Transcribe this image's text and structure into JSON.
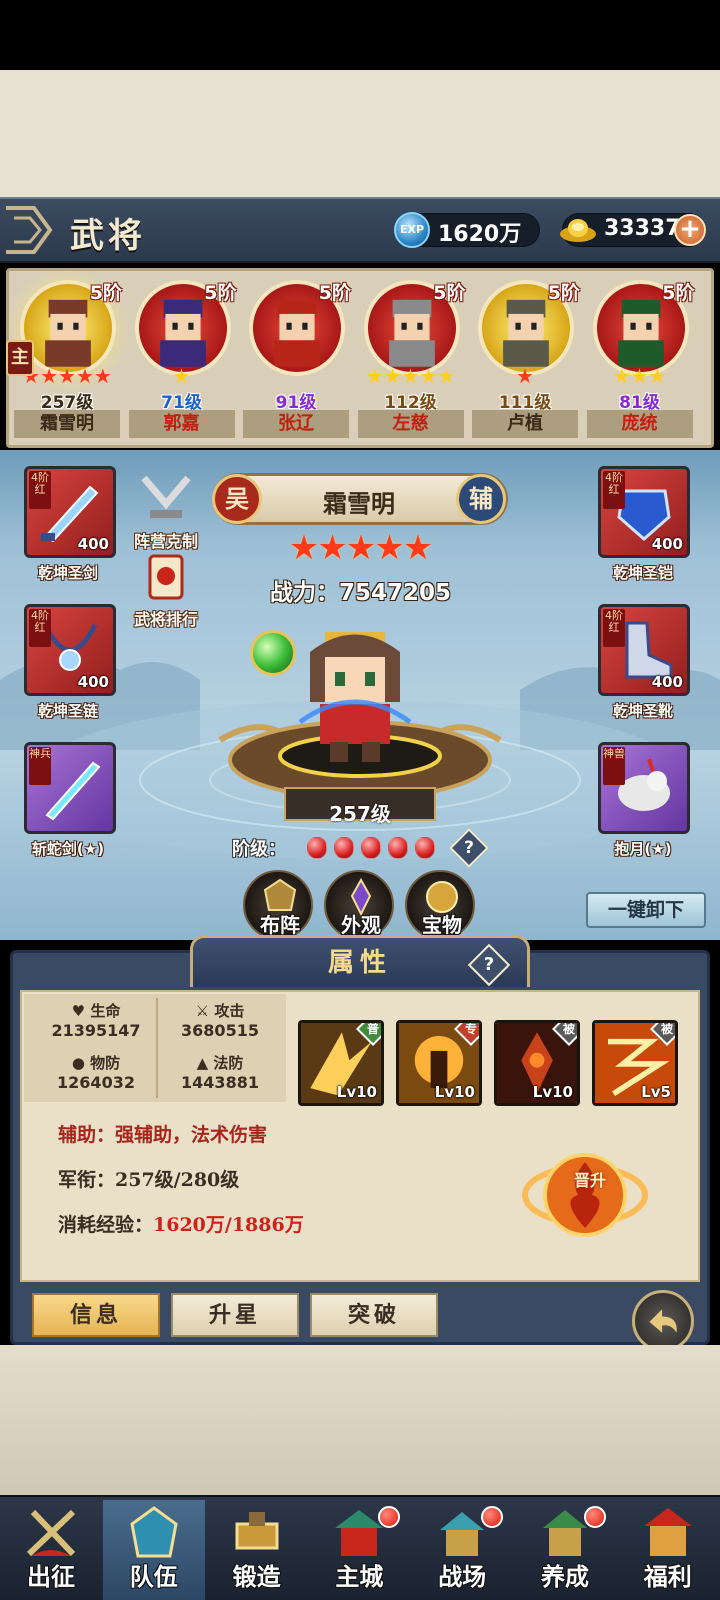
{
  "header": {
    "title": "武将",
    "exp_icon_text": "EXP",
    "exp_value": "1620万",
    "gold_value": "33337",
    "add_label": "+"
  },
  "roster": [
    {
      "name": "霜雪明",
      "rank": "5阶",
      "stars": "★★★★★",
      "star_color": "#ff3a1a",
      "level": "257级",
      "level_color": "#3a2a18",
      "name_color": "#3a2a18",
      "ring": "gold",
      "selected": true
    },
    {
      "name": "郭嘉",
      "rank": "5阶",
      "stars": "★",
      "star_color": "#ffcc22",
      "level": "71级",
      "level_color": "#1f5fd0",
      "name_color": "#c02010",
      "ring": "red",
      "selected": false
    },
    {
      "name": "张辽",
      "rank": "5阶",
      "stars": "",
      "star_color": "#ffcc22",
      "level": "91级",
      "level_color": "#8a2ad0",
      "name_color": "#c02010",
      "ring": "red",
      "selected": false
    },
    {
      "name": "左慈",
      "rank": "5阶",
      "stars": "★★★★★",
      "star_color": "#ffcc22",
      "level": "112级",
      "level_color": "#7a4a10",
      "name_color": "#c02010",
      "ring": "red",
      "selected": false
    },
    {
      "name": "卢植",
      "rank": "5阶",
      "stars": "★",
      "star_color": "#ff3a1a",
      "level": "111级",
      "level_color": "#7a4a10",
      "name_color": "#3a2a18",
      "ring": "gold",
      "selected": false
    },
    {
      "name": "庞统",
      "rank": "5阶",
      "stars": "★★★",
      "star_color": "#ffcc22",
      "level": "81级",
      "level_color": "#8a2ad0",
      "name_color": "#c02010",
      "ring": "red",
      "selected": false
    }
  ],
  "main_badge": "主",
  "left_equips": [
    {
      "name": "乾坤圣剑",
      "tag": "4阶红",
      "count": "400",
      "icon": "sword-icon"
    },
    {
      "name": "乾坤圣链",
      "tag": "4阶红",
      "count": "400",
      "icon": "necklace-icon"
    },
    {
      "name": "斩蛇剑(★)",
      "tag": "神兵",
      "count": "",
      "icon": "divine-sword-icon"
    }
  ],
  "right_equips": [
    {
      "name": "乾坤圣铠",
      "tag": "4阶红",
      "count": "400",
      "icon": "armor-icon"
    },
    {
      "name": "乾坤圣靴",
      "tag": "4阶红",
      "count": "400",
      "icon": "boots-icon"
    },
    {
      "name": "抱月(★)",
      "tag": "神兽",
      "count": "",
      "icon": "divine-mount-icon"
    }
  ],
  "side_buttons": {
    "formation_guide": "阵营克制",
    "ranking": "武将排行"
  },
  "hero": {
    "faction": "吴",
    "role": "辅",
    "name": "霜雪明",
    "stars": "★★★★★",
    "power_label": "战力：",
    "power_value": "7547205",
    "level": "257级",
    "grade_label": "阶级：",
    "grade_gems": 5,
    "help": "?"
  },
  "actions": {
    "formation": "布阵",
    "appearance": "外观",
    "treasure": "宝物",
    "unequip_all": "一键卸下"
  },
  "attributes": {
    "title": "属性",
    "help": "?",
    "stats": [
      {
        "key": "生命",
        "value": "21395147"
      },
      {
        "key": "攻击",
        "value": "3680515"
      },
      {
        "key": "物防",
        "value": "1264032"
      },
      {
        "key": "法防",
        "value": "1443881"
      }
    ],
    "skills": [
      {
        "tag": "普",
        "tag_color": "#3f8c3a",
        "level": "Lv10"
      },
      {
        "tag": "专",
        "tag_color": "#c0402a",
        "level": "Lv10"
      },
      {
        "tag": "被",
        "tag_color": "#5a5a5a",
        "level": "Lv10"
      },
      {
        "tag": "被",
        "tag_color": "#5a5a5a",
        "level": "Lv5"
      }
    ],
    "support_label": "辅助：",
    "support_value": "强辅助，法术伤害",
    "rank_label": "军衔：",
    "rank_value": "257级/280级",
    "exp_label": "消耗经验：",
    "exp_value": "1620万/1886万",
    "ascend_label": "晋升"
  },
  "tabs": {
    "info": "信息",
    "star_up": "升星",
    "breakthrough": "突破"
  },
  "nav": [
    {
      "label": "出征",
      "dot": false,
      "active": false
    },
    {
      "label": "队伍",
      "dot": false,
      "active": true
    },
    {
      "label": "锻造",
      "dot": false,
      "active": false
    },
    {
      "label": "主城",
      "dot": true,
      "active": false
    },
    {
      "label": "战场",
      "dot": true,
      "active": false
    },
    {
      "label": "养成",
      "dot": true,
      "active": false
    },
    {
      "label": "福利",
      "dot": false,
      "active": false
    }
  ]
}
